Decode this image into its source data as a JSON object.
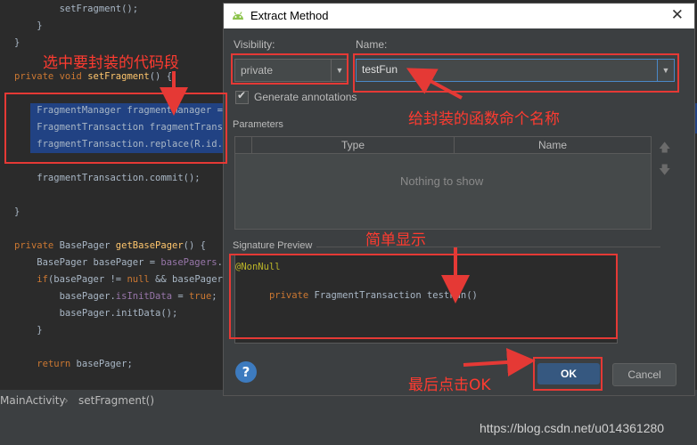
{
  "editor": {
    "lines": [
      {
        "segments": [
          {
            "t": "        setFragment();",
            "c": ""
          }
        ]
      },
      {
        "segments": [
          {
            "t": "    }",
            "c": ""
          }
        ]
      },
      {
        "segments": [
          {
            "t": "}",
            "c": ""
          }
        ]
      },
      {
        "segments": [
          {
            "t": "private void ",
            "c": "kw"
          },
          {
            "t": "setFragment",
            "c": "fn"
          },
          {
            "t": "() {",
            "c": ""
          }
        ]
      },
      {
        "segments": [
          {
            "t": "",
            "c": ""
          }
        ]
      },
      {
        "segments": [
          {
            "t": "    FragmentManager fragmentManager = g",
            "c": ""
          }
        ]
      },
      {
        "segments": [
          {
            "t": "    FragmentTransaction fragmentTransac",
            "c": ""
          }
        ]
      },
      {
        "segments": [
          {
            "t": "    fragmentTransaction.replace(R.id.f",
            "c": ""
          }
        ]
      },
      {
        "segments": [
          {
            "t": "",
            "c": ""
          }
        ]
      },
      {
        "segments": [
          {
            "t": "    fragmentTransaction.commit();",
            "c": ""
          }
        ]
      },
      {
        "segments": [
          {
            "t": "",
            "c": ""
          }
        ]
      },
      {
        "segments": [
          {
            "t": "}",
            "c": ""
          }
        ]
      },
      {
        "segments": [
          {
            "t": "",
            "c": ""
          }
        ]
      },
      {
        "segments": [
          {
            "t": "private ",
            "c": "kw"
          },
          {
            "t": "BasePager ",
            "c": ""
          },
          {
            "t": "getBasePager",
            "c": "fn"
          },
          {
            "t": "() {",
            "c": ""
          }
        ]
      },
      {
        "segments": [
          {
            "t": "    BasePager basePager = ",
            "c": ""
          },
          {
            "t": "basePagers",
            "c": "fld"
          },
          {
            "t": ".ge",
            "c": ""
          }
        ]
      },
      {
        "segments": [
          {
            "t": "    ",
            "c": ""
          },
          {
            "t": "if",
            "c": "kw"
          },
          {
            "t": "(basePager != ",
            "c": ""
          },
          {
            "t": "null",
            "c": "kw"
          },
          {
            "t": " && basePager.i",
            "c": ""
          }
        ]
      },
      {
        "segments": [
          {
            "t": "        basePager.",
            "c": ""
          },
          {
            "t": "isInitData",
            "c": "fld"
          },
          {
            "t": " = ",
            "c": ""
          },
          {
            "t": "true",
            "c": "kw"
          },
          {
            "t": ";",
            "c": ""
          }
        ]
      },
      {
        "segments": [
          {
            "t": "        basePager.initData();",
            "c": ""
          }
        ]
      },
      {
        "segments": [
          {
            "t": "    }",
            "c": ""
          }
        ]
      },
      {
        "segments": [
          {
            "t": "",
            "c": ""
          }
        ]
      },
      {
        "segments": [
          {
            "t": "    ",
            "c": ""
          },
          {
            "t": "return",
            "c": "kw"
          },
          {
            "t": " basePager;",
            "c": ""
          }
        ]
      }
    ]
  },
  "statusbar": {
    "crumb1": "MainActivity",
    "separator": "›",
    "crumb2": "setFragment()"
  },
  "dialog": {
    "title": "Extract Method",
    "visibility_label": "Visibility:",
    "visibility_value": "private",
    "name_label": "Name:",
    "name_value": "testFun",
    "generate_label": "Generate annotations",
    "generate_checked": true,
    "parameters_label": "Parameters",
    "columns": [
      "Type",
      "Name"
    ],
    "empty_text": "Nothing to show",
    "signature_label": "Signature Preview",
    "signature_lines": [
      "@NonNull",
      "private FragmentTransaction testFun()"
    ],
    "ok_label": "OK",
    "cancel_label": "Cancel",
    "help_symbol": "?"
  },
  "annotations": {
    "select_code": "选中要封装的代码段",
    "name_it": "给封装的函数命个名称",
    "preview": "简单显示",
    "click_ok": "最后点击OK"
  },
  "watermark": "https://blog.csdn.net/u014361280",
  "colors": {
    "accent_blue": "#365880",
    "annotation_red": "#e53935",
    "selection": "#214283"
  }
}
